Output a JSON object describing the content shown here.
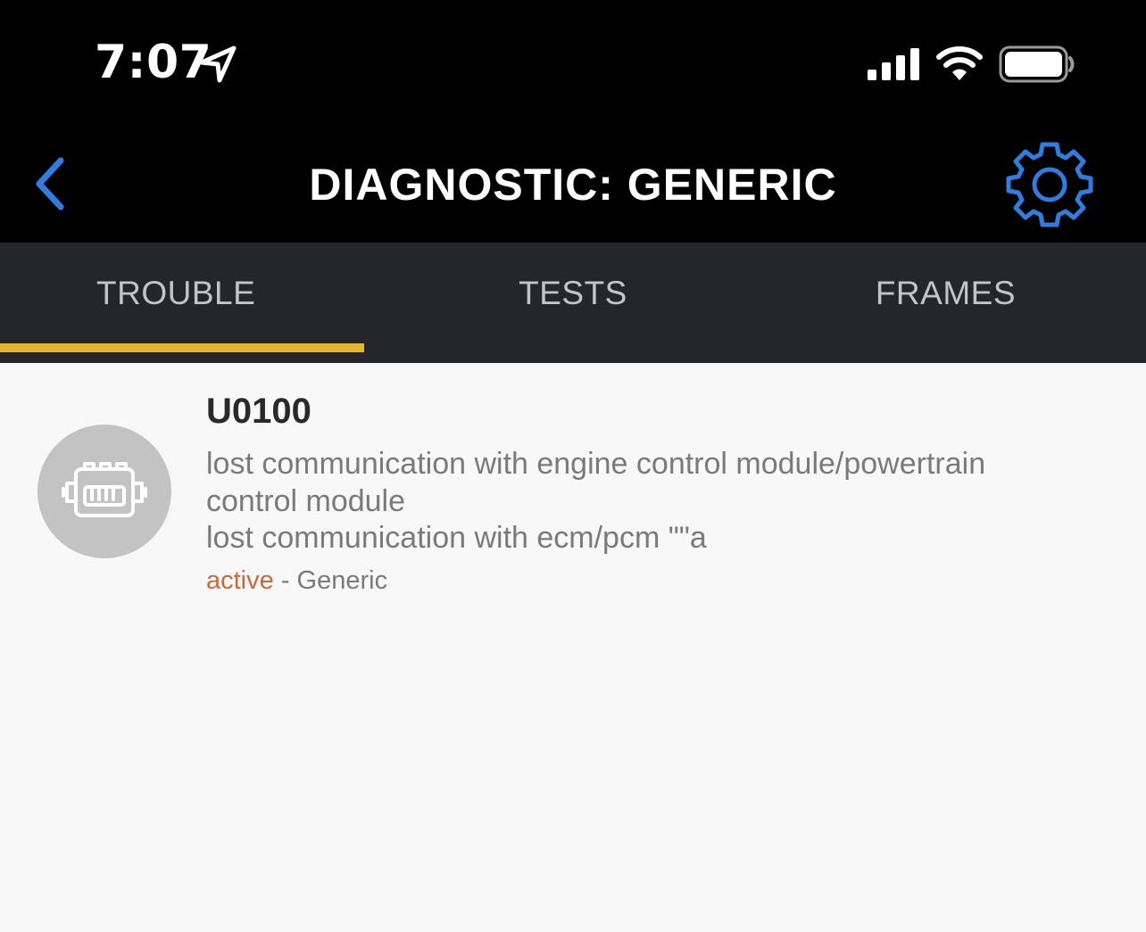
{
  "status_bar": {
    "time": "7:07",
    "icons": [
      "location-arrow-icon",
      "cellular-signal-icon",
      "wifi-icon",
      "battery-icon"
    ]
  },
  "nav": {
    "title": "DIAGNOSTIC: GENERIC",
    "back_icon": "chevron-left-icon",
    "settings_icon": "gear-icon",
    "accent_color": "#2f7de1"
  },
  "tabs": [
    {
      "label": "TROUBLE",
      "selected": true
    },
    {
      "label": "TESTS",
      "selected": false
    },
    {
      "label": "FRAMES",
      "selected": false
    }
  ],
  "tab_indicator_color": "#e8b531",
  "trouble_codes": [
    {
      "icon": "engine-icon",
      "code": "U0100",
      "description_lines": [
        "lost communication with engine control module/powertrain",
        "control module",
        "lost communication with ecm/pcm \"\"a"
      ],
      "status": "active",
      "separator": " - ",
      "source": "Generic",
      "status_color": "#c86a3c"
    }
  ]
}
